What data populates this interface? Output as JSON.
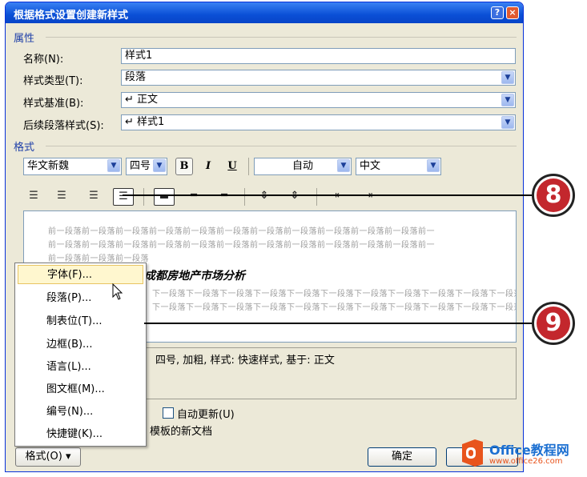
{
  "window": {
    "title": "根据格式设置创建新样式",
    "help": "?",
    "close": "×"
  },
  "properties": {
    "section": "属性",
    "name_label": "名称(N):",
    "name_value": "样式1",
    "type_label": "样式类型(T):",
    "type_value": "段落",
    "base_label": "样式基准(B):",
    "base_value": "↵ 正文",
    "next_label": "后续段落样式(S):",
    "next_value": "↵ 样式1"
  },
  "format": {
    "section": "格式",
    "font": "华文新魏",
    "size": "四号",
    "bold": "B",
    "italic": "I",
    "underline": "U",
    "color": "自动",
    "script": "中文"
  },
  "align_icons": [
    "align-left-icon",
    "align-center-icon",
    "align-right-icon",
    "align-justify-icon",
    "align-distributed-icon",
    "spacing-single-icon",
    "spacing-double-icon",
    "line-spacing-increase-icon",
    "line-spacing-decrease-icon",
    "indent-decrease-icon",
    "indent-increase-icon"
  ],
  "preview": {
    "prev_line": "前一段落前一段落前一段落前一段落前一段落前一段落前一段落前一段落前一段落前一段落前一段落前一",
    "prev_last": "前一段落前一段落前一段落",
    "sample": "成都房地产市场分析",
    "next_line": "下一段落下一段落下一段落下一段落下一段落下一段落下一段落下一段落下一段落下一段落下一段落下一",
    "next_line2": "下一段落下一段落下一段落下一段落下一段落下一段落下一段落下一段落下一段落下一段落下一段落下一"
  },
  "description": "四号, 加粗, 样式: 快速样式, 基于: 正文",
  "options": {
    "auto_update": "自动更新(U)",
    "new_docs": "模板的新文档"
  },
  "menu": {
    "items": [
      "字体(F)...",
      "段落(P)...",
      "制表位(T)...",
      "边框(B)...",
      "语言(L)...",
      "图文框(M)...",
      "编号(N)...",
      "快捷键(K)..."
    ]
  },
  "buttons": {
    "format": "格式(O) ▾",
    "ok": "确定"
  },
  "callouts": [
    "8",
    "9"
  ],
  "watermark": {
    "brand": "Office教程网",
    "url": "www.office26.com"
  }
}
